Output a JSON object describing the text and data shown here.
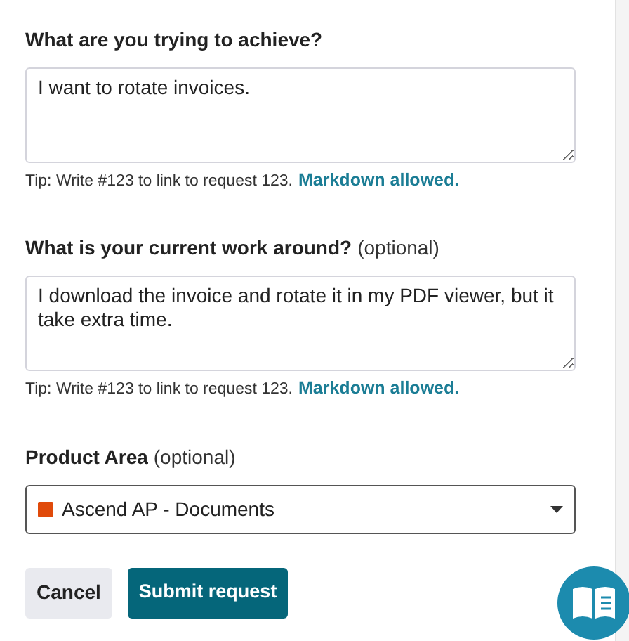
{
  "fields": [
    {
      "kind": "textarea",
      "label": "What are you trying to achieve?",
      "value": "I want to rotate invoices.",
      "tip": "Tip: Write #123 to link to request 123.",
      "tip_link": "Markdown allowed."
    },
    {
      "kind": "textarea",
      "label": "What is your current work around?",
      "optional": "(optional)",
      "value": "I download the invoice and rotate it in my PDF viewer, but it take extra time.",
      "tip": "Tip: Write #123 to link to request 123.",
      "tip_link": "Markdown allowed."
    },
    {
      "kind": "select",
      "label": "Product Area",
      "optional": "(optional)",
      "value": "Ascend AP - Documents",
      "color": "#e04a0a"
    }
  ],
  "buttons": [
    {
      "kind": "secondary",
      "label": "Cancel"
    },
    {
      "kind": "primary",
      "label": "Submit request"
    }
  ]
}
